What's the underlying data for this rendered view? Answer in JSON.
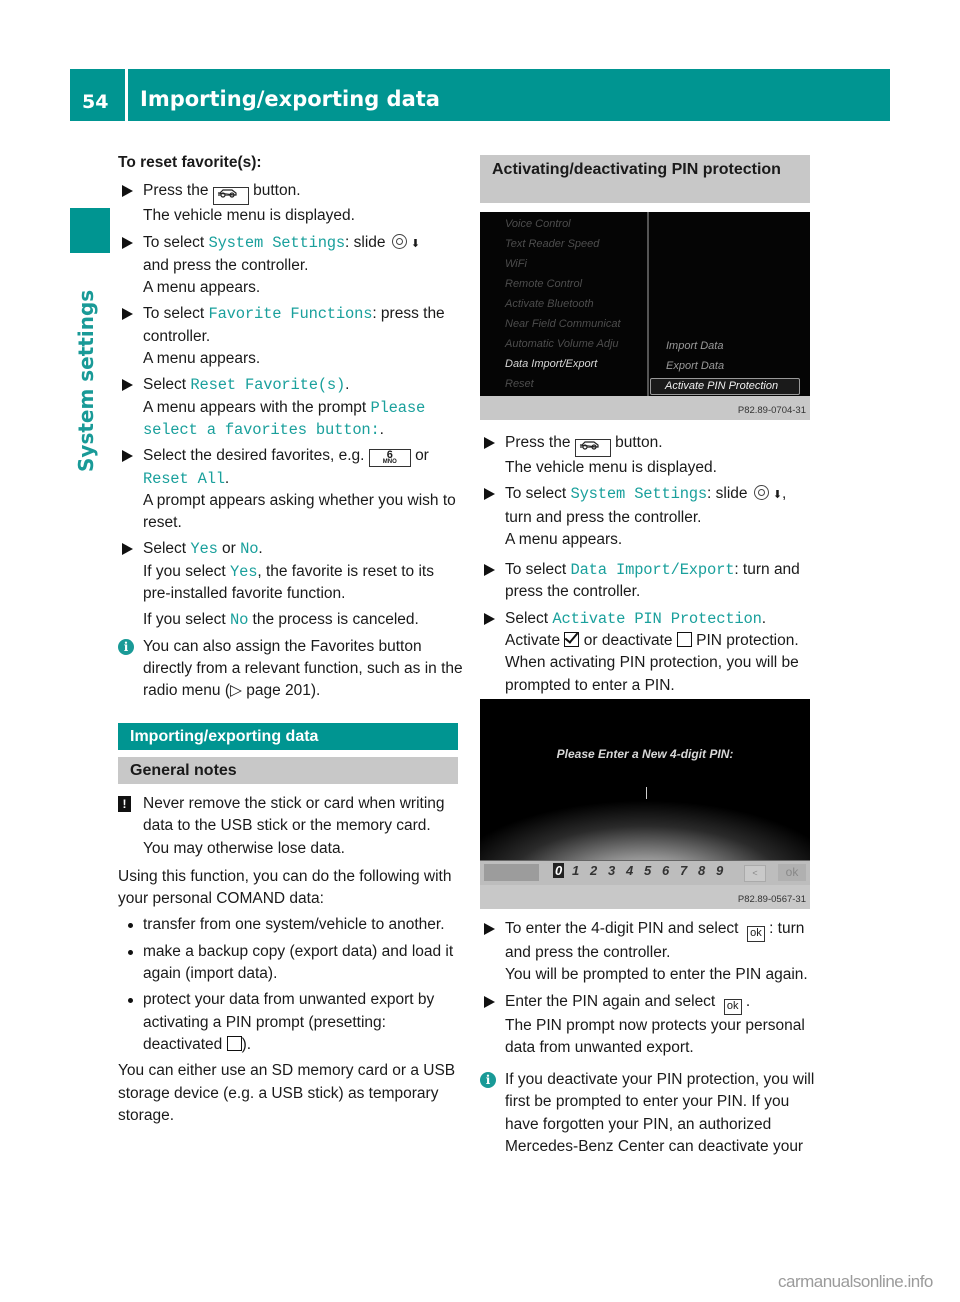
{
  "header": {
    "page_number": "54",
    "title": "Importing/exporting data"
  },
  "side_tab": {
    "label": "System settings"
  },
  "left": {
    "reset_title": "To reset favorite(s):",
    "steps": [
      {
        "pre": "Press the",
        "post": "button.",
        "result": "The vehicle menu is displayed."
      },
      {
        "pre": "To select",
        "code": "System Settings",
        "post": ": slide",
        "post2": "and press the controller.",
        "result": "A menu appears."
      },
      {
        "pre": "To select",
        "code": "Favorite Functions",
        "post": ": press the controller.",
        "result": "A menu appears."
      },
      {
        "pre": "Select",
        "code": "Reset Favorite(s)",
        "post": ".",
        "result_pre": "A menu appears with the prompt",
        "result_code": "Please select a favorites button:",
        "result_post": "."
      },
      {
        "pre": "Select the desired favorites, e.g.",
        "key_digit": "6",
        "key_letters": "MNO",
        "mid": "or",
        "code": "Reset All",
        "post": ".",
        "result": "A prompt appears asking whether you wish to reset."
      },
      {
        "pre": "Select",
        "code": "Yes",
        "mid": "or",
        "code2": "No",
        "post": ".",
        "result_pre": "If you select",
        "result_code": "Yes",
        "result_post": ", the favorite is reset to its pre-installed favorite function.",
        "result2_pre": "If you select",
        "result2_code": "No",
        "result2_post": "the process is canceled."
      }
    ],
    "info": "You can also assign the Favorites button directly from a relevant function, such as in the radio menu (▷ page 201).",
    "section_title": "Importing/exporting data",
    "subsection_title": "General notes",
    "warning": "Never remove the stick or card when writing data to the USB stick or the memory card. You may otherwise lose data.",
    "intro": "Using this function, you can do the following with your personal COMAND data:",
    "bullets": [
      "transfer from one system/vehicle to another.",
      "make a backup copy (export data) and load it again (import data).",
      "protect your data from unwanted export by activating a PIN prompt (presetting: deactivated"
    ],
    "bullet3_end": ").",
    "outro": "You can either use an SD memory card or a USB storage device (e.g. a USB stick) as temporary storage."
  },
  "right": {
    "section_title": "Activating/deactivating PIN protection",
    "screen1": {
      "left_menu": [
        "Voice Control",
        "Text Reader Speed",
        "WiFi",
        "Remote Control",
        "Activate Bluetooth",
        "Near Field Communicat",
        "Automatic Volume Adju",
        "Data Import/Export",
        "Reset"
      ],
      "right_menu": [
        "Import Data",
        "Export Data",
        "Activate PIN Protection"
      ],
      "caption": "P82.89-0704-31"
    },
    "steps": [
      {
        "pre": "Press the",
        "post": "button.",
        "result": "The vehicle menu is displayed."
      },
      {
        "pre": "To select",
        "code": "System Settings",
        "post": ": slide",
        "post2": ", turn and press the controller.",
        "result": "A menu appears."
      },
      {
        "pre": "To select",
        "code": "Data Import/Export",
        "post": ": turn and press the controller."
      },
      {
        "pre": "Select",
        "code": "Activate PIN Protection",
        "post": ".",
        "r1": "Activate",
        "r2": "or deactivate",
        "r3": "PIN protection. When activating PIN protection, you will be prompted to enter a PIN."
      }
    ],
    "screen2": {
      "prompt": "Please Enter a New 4-digit PIN:",
      "digits": [
        "0",
        "1",
        "2",
        "3",
        "4",
        "5",
        "6",
        "7",
        "8",
        "9"
      ],
      "delete_label": "<",
      "ok_label": "ok",
      "caption": "P82.89-0567-31"
    },
    "steps2": [
      {
        "pre": "To enter the 4-digit PIN and select",
        "ok": "ok",
        "post": ": turn and press the controller.",
        "result": "You will be prompted to enter the PIN again."
      },
      {
        "pre": "Enter the PIN again and select",
        "ok": "ok",
        "post": ".",
        "result": "The PIN prompt now protects your personal data from unwanted export."
      }
    ],
    "info": "If you deactivate your PIN protection, you will first be prompted to enter your PIN. If you have forgotten your PIN, an authorized Mercedes-Benz Center can deactivate your"
  },
  "watermark": "carmanualsonline.info"
}
